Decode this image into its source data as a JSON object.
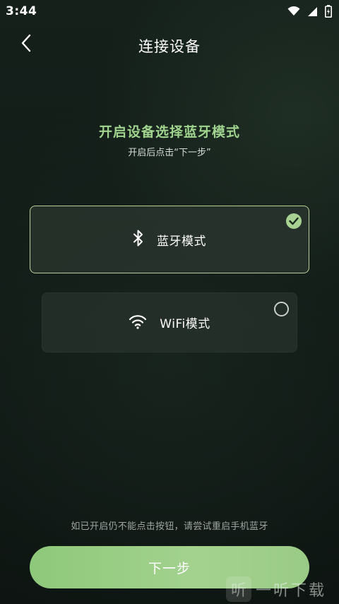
{
  "status_bar": {
    "time": "3:44",
    "icons": [
      "wifi-icon",
      "signal-icon",
      "battery-charging-icon"
    ]
  },
  "nav": {
    "title": "连接设备",
    "back_icon": "chevron-left-icon"
  },
  "heading": "开启设备选择蓝牙模式",
  "subheading": "开启后点击“下一步”",
  "modes": [
    {
      "label": "蓝牙模式",
      "icon": "bluetooth-icon",
      "selected": true
    },
    {
      "label": "WiFi模式",
      "icon": "wifi-icon",
      "selected": false
    }
  ],
  "hint": "如已开启仍不能点击按钮，请尝试重启手机蓝牙",
  "next_button": {
    "label": "下一步"
  },
  "watermark": {
    "logo_glyph": "听",
    "text": "一听下载"
  },
  "colors": {
    "accent": "#a3d28f",
    "heading": "#9fd38e",
    "selected_border": "#b8cf9a",
    "background": "#121b17"
  }
}
